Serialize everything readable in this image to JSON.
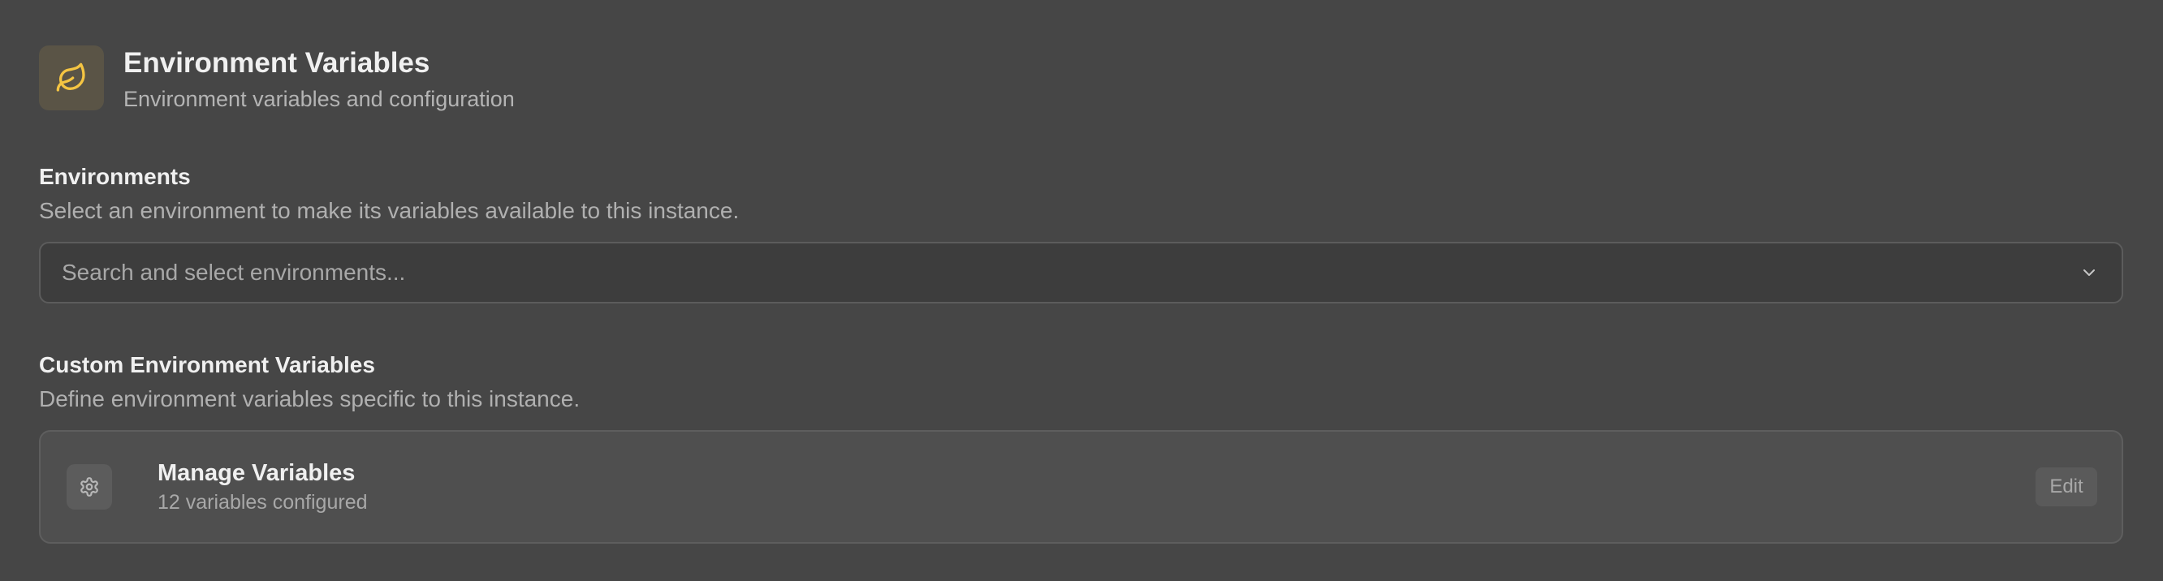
{
  "header": {
    "icon": "leaf-icon",
    "title": "Environment Variables",
    "subtitle": "Environment variables and configuration"
  },
  "environments": {
    "title": "Environments",
    "description": "Select an environment to make its variables available to this instance.",
    "select": {
      "placeholder": "Search and select environments...",
      "icon": "chevron-down-icon"
    }
  },
  "custom_variables": {
    "title": "Custom Environment Variables",
    "description": "Define environment variables specific to this instance.",
    "card": {
      "icon": "gear-icon",
      "title": "Manage Variables",
      "count_text": "12 variables configured",
      "edit_label": "Edit"
    }
  },
  "colors": {
    "background": "#464646",
    "accent_icon": "#f5c542"
  }
}
